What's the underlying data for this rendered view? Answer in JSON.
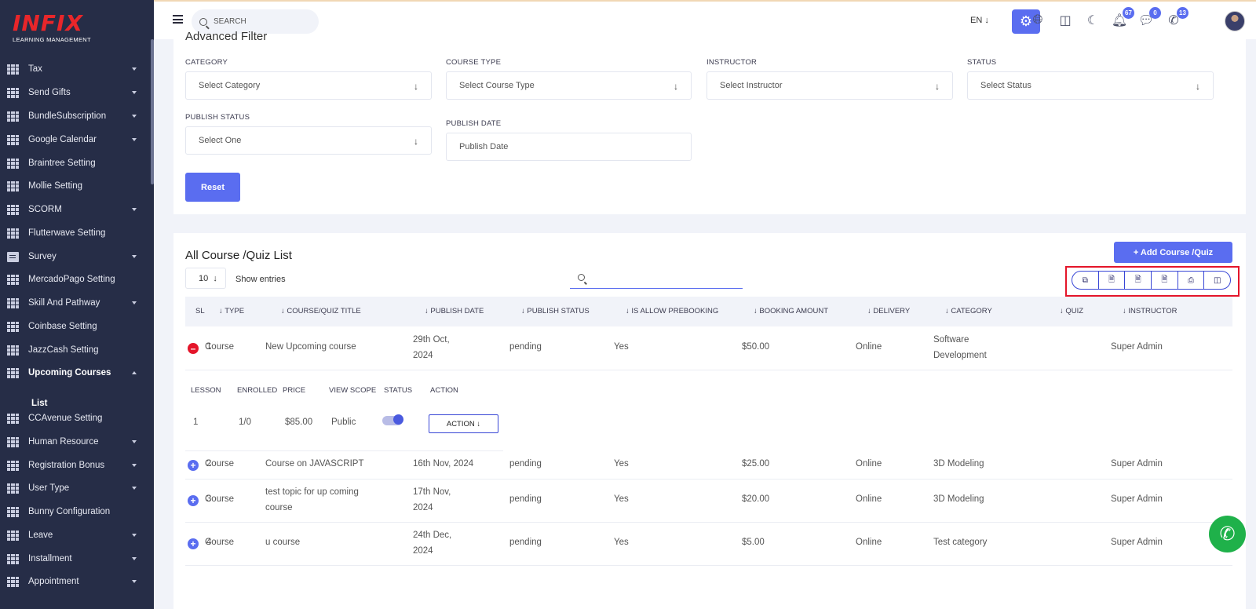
{
  "brand": {
    "logo": "INFIX",
    "sub": "LEARNING MANAGEMENT"
  },
  "sidebar": {
    "items": [
      {
        "label": "Tax",
        "icon": "grid-icon",
        "expandable": true
      },
      {
        "label": "Send Gifts",
        "icon": "grid-icon",
        "expandable": true
      },
      {
        "label": "BundleSubscription",
        "icon": "grid-icon",
        "expandable": true
      },
      {
        "label": "Google Calendar",
        "icon": "grid-icon",
        "expandable": true
      },
      {
        "label": "Braintree Setting",
        "icon": "grid-icon",
        "expandable": false
      },
      {
        "label": "Mollie Setting",
        "icon": "grid-icon",
        "expandable": false
      },
      {
        "label": "SCORM",
        "icon": "grid-icon",
        "expandable": true
      },
      {
        "label": "Flutterwave Setting",
        "icon": "grid-icon",
        "expandable": false
      },
      {
        "label": "Survey",
        "icon": "document-icon",
        "expandable": true
      },
      {
        "label": "MercadoPago Setting",
        "icon": "grid-icon",
        "expandable": false
      },
      {
        "label": "Skill And Pathway",
        "icon": "grid-icon",
        "expandable": true
      },
      {
        "label": "Coinbase Setting",
        "icon": "grid-icon",
        "expandable": false
      },
      {
        "label": "JazzCash Setting",
        "icon": "grid-icon",
        "expandable": false
      },
      {
        "label": "Upcoming Courses",
        "icon": "grid-icon",
        "expandable": true,
        "active": true
      },
      {
        "label": "CCAvenue Setting",
        "icon": "grid-icon",
        "expandable": false
      },
      {
        "label": "Human Resource",
        "icon": "grid-icon",
        "expandable": true
      },
      {
        "label": "Registration Bonus",
        "icon": "grid-icon",
        "expandable": true
      },
      {
        "label": "User Type",
        "icon": "grid-icon",
        "expandable": true
      },
      {
        "label": "Bunny Configuration",
        "icon": "grid-icon",
        "expandable": false
      },
      {
        "label": "Leave",
        "icon": "grid-icon",
        "expandable": true
      },
      {
        "label": "Installment",
        "icon": "grid-icon",
        "expandable": true
      },
      {
        "label": "Appointment",
        "icon": "grid-icon",
        "expandable": true
      }
    ],
    "sub_item": "List"
  },
  "header": {
    "search_placeholder": "SEARCH",
    "lang": "EN",
    "notifications": "67",
    "messages": "0",
    "chats": "13"
  },
  "filter": {
    "title": "Advanced Filter",
    "category_label": "CATEGORY",
    "category_value": "Select Category",
    "course_type_label": "COURSE TYPE",
    "course_type_value": "Select Course Type",
    "instructor_label": "INSTRUCTOR",
    "instructor_value": "Select Instructor",
    "status_label": "STATUS",
    "status_value": "Select Status",
    "publish_status_label": "PUBLISH STATUS",
    "publish_status_value": "Select One",
    "publish_date_label": "PUBLISH DATE",
    "publish_date_placeholder": "Publish Date",
    "reset": "Reset"
  },
  "list": {
    "title": "All Course /Quiz List",
    "add_button": "+ Add Course /Quiz",
    "page_size": "10",
    "show_entries": "Show entries",
    "columns": [
      "SL",
      "↓ TYPE",
      "↓ COURSE/QUIZ TITLE",
      "↓ PUBLISH DATE",
      "↓ PUBLISH STATUS",
      "↓ IS ALLOW PREBOOKING",
      "↓ BOOKING AMOUNT",
      "↓ DELIVERY",
      "↓ CATEGORY",
      "↓ QUIZ",
      "↓ INSTRUCTOR"
    ],
    "rows": [
      {
        "sl": "1",
        "type": "Course",
        "title": "New Upcoming course",
        "date": "29th Oct, 2024",
        "status": "pending",
        "prebook": "Yes",
        "amount": "$50.00",
        "delivery": "Online",
        "category": "Software Development",
        "quiz": "",
        "instructor": "Super Admin"
      },
      {
        "sl": "2",
        "type": "Course",
        "title": "Course on JAVASCRIPT",
        "date": "16th Nov, 2024",
        "status": "pending",
        "prebook": "Yes",
        "amount": "$25.00",
        "delivery": "Online",
        "category": "3D Modeling",
        "quiz": "",
        "instructor": "Super Admin"
      },
      {
        "sl": "3",
        "type": "Course",
        "title": "test topic for up coming course",
        "date": "17th Nov, 2024",
        "status": "pending",
        "prebook": "Yes",
        "amount": "$20.00",
        "delivery": "Online",
        "category": "3D Modeling",
        "quiz": "",
        "instructor": "Super Admin"
      },
      {
        "sl": "4",
        "type": "Course",
        "title": "u course",
        "date": "24th Dec, 2024",
        "status": "pending",
        "prebook": "Yes",
        "amount": "$5.00",
        "delivery": "Online",
        "category": "Test category",
        "quiz": "",
        "instructor": "Super Admin"
      }
    ],
    "detail": {
      "columns": [
        "LESSON",
        "ENROLLED",
        "PRICE",
        "VIEW SCOPE",
        "STATUS",
        "ACTION"
      ],
      "lesson": "1",
      "enrolled": "1/0",
      "price": "$85.00",
      "scope": "Public",
      "status_on": true,
      "action": "ACTION ↓"
    }
  },
  "colors": {
    "primary": "#5a6df0",
    "sidebar": "#262d47",
    "highlight": "#e4152a",
    "whatsapp": "#1fb14a"
  }
}
